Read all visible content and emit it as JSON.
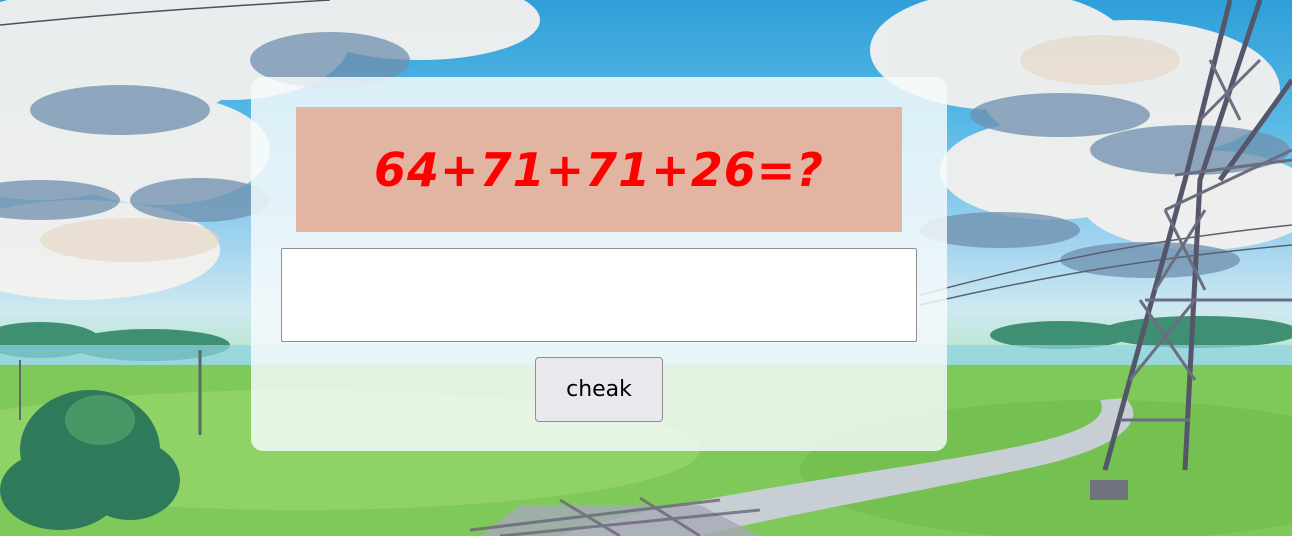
{
  "captcha": {
    "question": "64+71+71+26=?",
    "answer_value": "",
    "button_label": "cheak"
  },
  "colors": {
    "question_background": "#e2b4a2",
    "question_text": "#ff0000",
    "card_background": "rgba(245,250,252,0.84)",
    "button_background": "#e9e9ed"
  }
}
